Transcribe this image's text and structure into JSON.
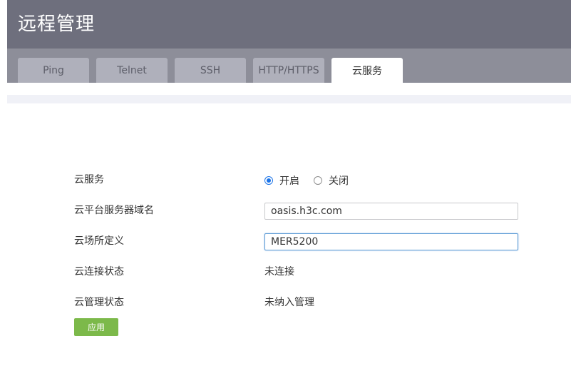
{
  "header": {
    "title": "远程管理"
  },
  "tabs": [
    {
      "label": "Ping"
    },
    {
      "label": "Telnet"
    },
    {
      "label": "SSH"
    },
    {
      "label": "HTTP/HTTPS"
    },
    {
      "label": "云服务",
      "active": true
    }
  ],
  "form": {
    "cloud_service": {
      "label": "云服务",
      "options": [
        "开启",
        "关闭"
      ],
      "selected": "开启"
    },
    "domain": {
      "label": "云平台服务器域名",
      "value": "oasis.h3c.com"
    },
    "site": {
      "label": "云场所定义",
      "value": "MER5200"
    },
    "connect_status": {
      "label": "云连接状态",
      "value": "未连接"
    },
    "manage_status": {
      "label": "云管理状态",
      "value": "未纳入管理"
    }
  },
  "apply_label": "应用",
  "colors": {
    "header_bg": "#6e6f7d",
    "tab_active": "#ffffff",
    "accent_radio": "#1a73e8",
    "apply_button": "#7cb94a"
  }
}
